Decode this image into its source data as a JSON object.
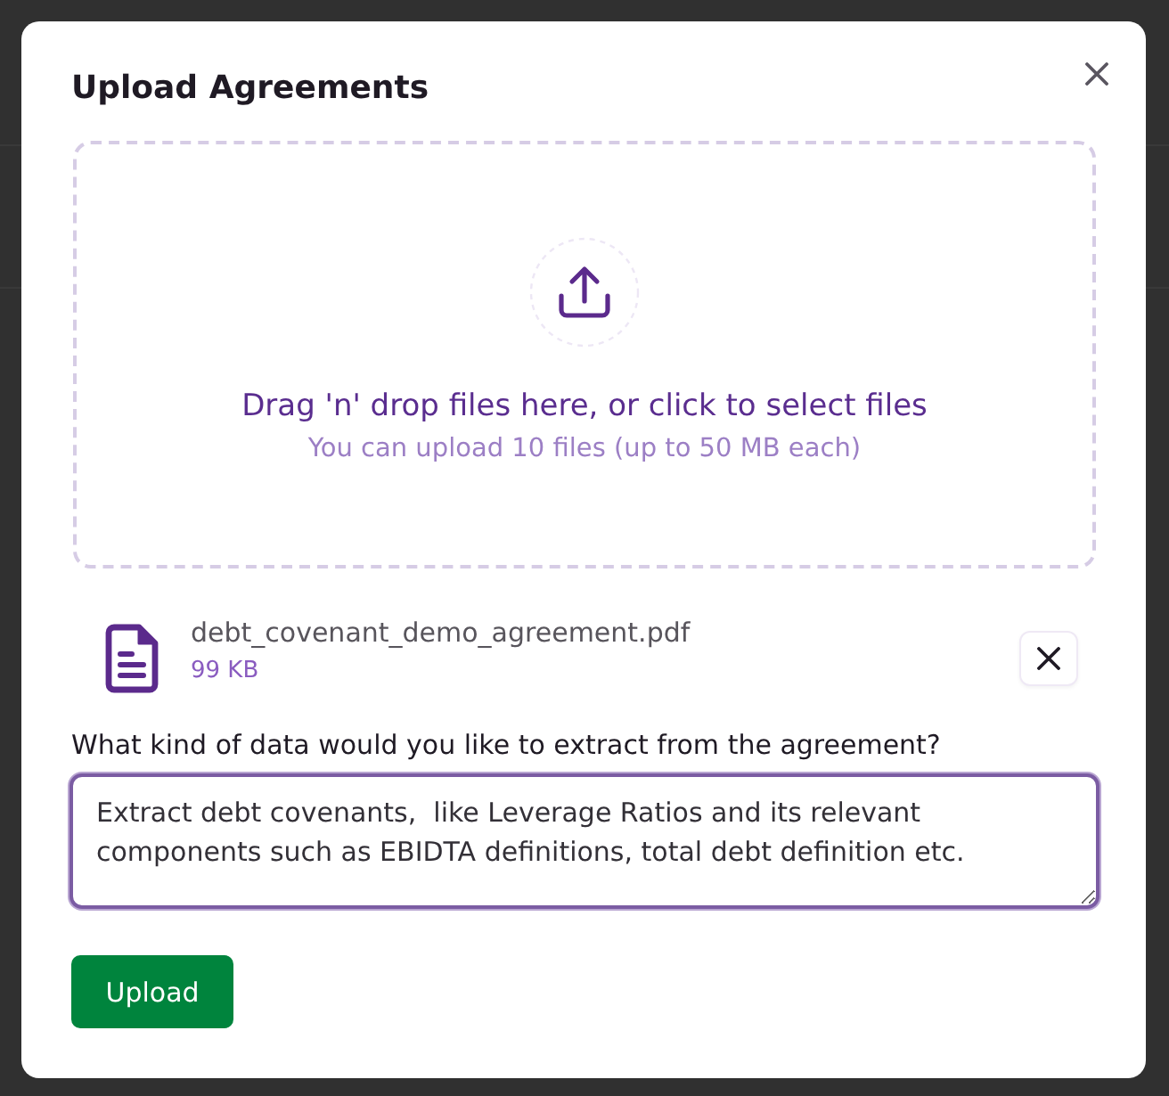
{
  "dialog": {
    "title": "Upload Agreements",
    "dropzone": {
      "prompt": "Drag 'n' drop files here, or click to select files",
      "hint": "You can upload 10 files (up to 50 MB each)"
    },
    "files": [
      {
        "name": "debt_covenant_demo_agreement.pdf",
        "size": "99 KB"
      }
    ],
    "question": {
      "label": "What kind of data would you like to extract from the agreement?",
      "value": "Extract debt covenants,  like Leverage Ratios and its relevant\ncomponents such as EBIDTA definitions, total debt definition etc.",
      "focused": true
    },
    "submit": "Upload"
  }
}
